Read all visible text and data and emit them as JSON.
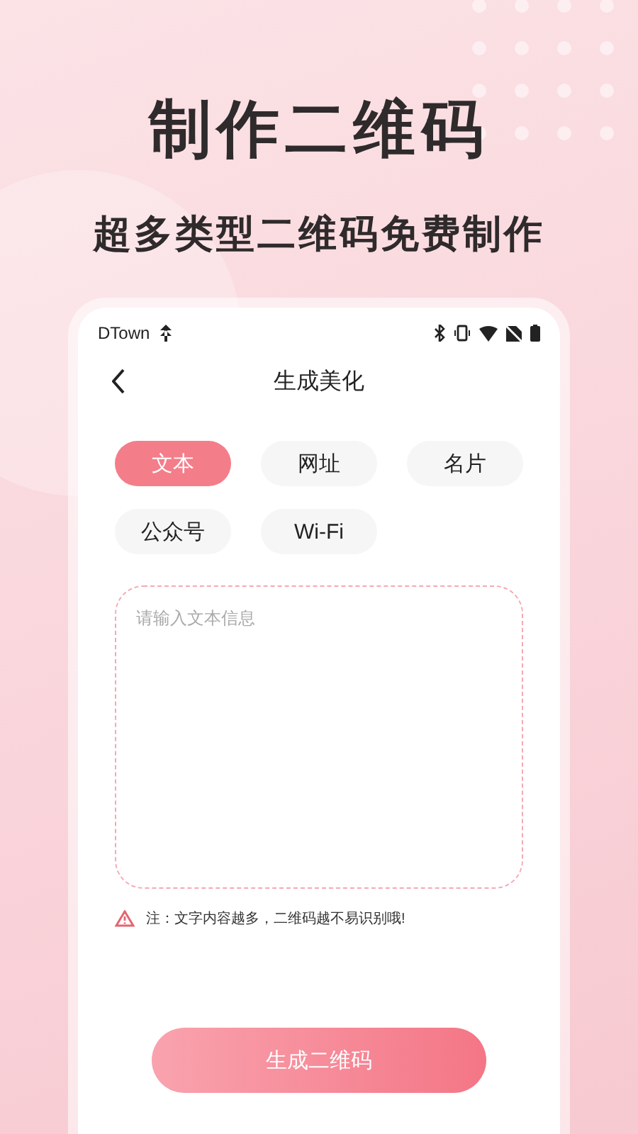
{
  "promo": {
    "title": "制作二维码",
    "subtitle": "超多类型二维码免费制作"
  },
  "status_bar": {
    "carrier": "DTown"
  },
  "header": {
    "title": "生成美化"
  },
  "types": [
    {
      "label": "文本",
      "selected": true
    },
    {
      "label": "网址",
      "selected": false
    },
    {
      "label": "名片",
      "selected": false
    },
    {
      "label": "公众号",
      "selected": false
    },
    {
      "label": "Wi-Fi",
      "selected": false
    }
  ],
  "input": {
    "placeholder": "请输入文本信息"
  },
  "note": "注：文字内容越多，二维码越不易识别哦!",
  "submit": "生成二维码"
}
